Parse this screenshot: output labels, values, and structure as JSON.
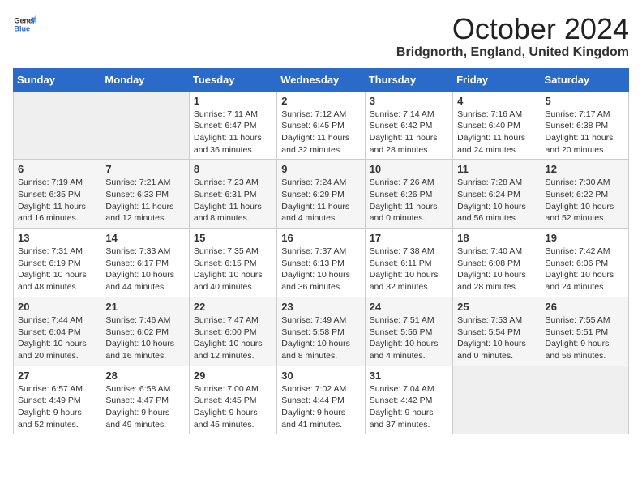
{
  "header": {
    "logo_general": "General",
    "logo_blue": "Blue",
    "month_title": "October 2024",
    "location": "Bridgnorth, England, United Kingdom"
  },
  "days_of_week": [
    "Sunday",
    "Monday",
    "Tuesday",
    "Wednesday",
    "Thursday",
    "Friday",
    "Saturday"
  ],
  "weeks": [
    [
      {
        "day": "",
        "sunrise": "",
        "sunset": "",
        "daylight": ""
      },
      {
        "day": "",
        "sunrise": "",
        "sunset": "",
        "daylight": ""
      },
      {
        "day": "1",
        "sunrise": "Sunrise: 7:11 AM",
        "sunset": "Sunset: 6:47 PM",
        "daylight": "Daylight: 11 hours and 36 minutes."
      },
      {
        "day": "2",
        "sunrise": "Sunrise: 7:12 AM",
        "sunset": "Sunset: 6:45 PM",
        "daylight": "Daylight: 11 hours and 32 minutes."
      },
      {
        "day": "3",
        "sunrise": "Sunrise: 7:14 AM",
        "sunset": "Sunset: 6:42 PM",
        "daylight": "Daylight: 11 hours and 28 minutes."
      },
      {
        "day": "4",
        "sunrise": "Sunrise: 7:16 AM",
        "sunset": "Sunset: 6:40 PM",
        "daylight": "Daylight: 11 hours and 24 minutes."
      },
      {
        "day": "5",
        "sunrise": "Sunrise: 7:17 AM",
        "sunset": "Sunset: 6:38 PM",
        "daylight": "Daylight: 11 hours and 20 minutes."
      }
    ],
    [
      {
        "day": "6",
        "sunrise": "Sunrise: 7:19 AM",
        "sunset": "Sunset: 6:35 PM",
        "daylight": "Daylight: 11 hours and 16 minutes."
      },
      {
        "day": "7",
        "sunrise": "Sunrise: 7:21 AM",
        "sunset": "Sunset: 6:33 PM",
        "daylight": "Daylight: 11 hours and 12 minutes."
      },
      {
        "day": "8",
        "sunrise": "Sunrise: 7:23 AM",
        "sunset": "Sunset: 6:31 PM",
        "daylight": "Daylight: 11 hours and 8 minutes."
      },
      {
        "day": "9",
        "sunrise": "Sunrise: 7:24 AM",
        "sunset": "Sunset: 6:29 PM",
        "daylight": "Daylight: 11 hours and 4 minutes."
      },
      {
        "day": "10",
        "sunrise": "Sunrise: 7:26 AM",
        "sunset": "Sunset: 6:26 PM",
        "daylight": "Daylight: 11 hours and 0 minutes."
      },
      {
        "day": "11",
        "sunrise": "Sunrise: 7:28 AM",
        "sunset": "Sunset: 6:24 PM",
        "daylight": "Daylight: 10 hours and 56 minutes."
      },
      {
        "day": "12",
        "sunrise": "Sunrise: 7:30 AM",
        "sunset": "Sunset: 6:22 PM",
        "daylight": "Daylight: 10 hours and 52 minutes."
      }
    ],
    [
      {
        "day": "13",
        "sunrise": "Sunrise: 7:31 AM",
        "sunset": "Sunset: 6:19 PM",
        "daylight": "Daylight: 10 hours and 48 minutes."
      },
      {
        "day": "14",
        "sunrise": "Sunrise: 7:33 AM",
        "sunset": "Sunset: 6:17 PM",
        "daylight": "Daylight: 10 hours and 44 minutes."
      },
      {
        "day": "15",
        "sunrise": "Sunrise: 7:35 AM",
        "sunset": "Sunset: 6:15 PM",
        "daylight": "Daylight: 10 hours and 40 minutes."
      },
      {
        "day": "16",
        "sunrise": "Sunrise: 7:37 AM",
        "sunset": "Sunset: 6:13 PM",
        "daylight": "Daylight: 10 hours and 36 minutes."
      },
      {
        "day": "17",
        "sunrise": "Sunrise: 7:38 AM",
        "sunset": "Sunset: 6:11 PM",
        "daylight": "Daylight: 10 hours and 32 minutes."
      },
      {
        "day": "18",
        "sunrise": "Sunrise: 7:40 AM",
        "sunset": "Sunset: 6:08 PM",
        "daylight": "Daylight: 10 hours and 28 minutes."
      },
      {
        "day": "19",
        "sunrise": "Sunrise: 7:42 AM",
        "sunset": "Sunset: 6:06 PM",
        "daylight": "Daylight: 10 hours and 24 minutes."
      }
    ],
    [
      {
        "day": "20",
        "sunrise": "Sunrise: 7:44 AM",
        "sunset": "Sunset: 6:04 PM",
        "daylight": "Daylight: 10 hours and 20 minutes."
      },
      {
        "day": "21",
        "sunrise": "Sunrise: 7:46 AM",
        "sunset": "Sunset: 6:02 PM",
        "daylight": "Daylight: 10 hours and 16 minutes."
      },
      {
        "day": "22",
        "sunrise": "Sunrise: 7:47 AM",
        "sunset": "Sunset: 6:00 PM",
        "daylight": "Daylight: 10 hours and 12 minutes."
      },
      {
        "day": "23",
        "sunrise": "Sunrise: 7:49 AM",
        "sunset": "Sunset: 5:58 PM",
        "daylight": "Daylight: 10 hours and 8 minutes."
      },
      {
        "day": "24",
        "sunrise": "Sunrise: 7:51 AM",
        "sunset": "Sunset: 5:56 PM",
        "daylight": "Daylight: 10 hours and 4 minutes."
      },
      {
        "day": "25",
        "sunrise": "Sunrise: 7:53 AM",
        "sunset": "Sunset: 5:54 PM",
        "daylight": "Daylight: 10 hours and 0 minutes."
      },
      {
        "day": "26",
        "sunrise": "Sunrise: 7:55 AM",
        "sunset": "Sunset: 5:51 PM",
        "daylight": "Daylight: 9 hours and 56 minutes."
      }
    ],
    [
      {
        "day": "27",
        "sunrise": "Sunrise: 6:57 AM",
        "sunset": "Sunset: 4:49 PM",
        "daylight": "Daylight: 9 hours and 52 minutes."
      },
      {
        "day": "28",
        "sunrise": "Sunrise: 6:58 AM",
        "sunset": "Sunset: 4:47 PM",
        "daylight": "Daylight: 9 hours and 49 minutes."
      },
      {
        "day": "29",
        "sunrise": "Sunrise: 7:00 AM",
        "sunset": "Sunset: 4:45 PM",
        "daylight": "Daylight: 9 hours and 45 minutes."
      },
      {
        "day": "30",
        "sunrise": "Sunrise: 7:02 AM",
        "sunset": "Sunset: 4:44 PM",
        "daylight": "Daylight: 9 hours and 41 minutes."
      },
      {
        "day": "31",
        "sunrise": "Sunrise: 7:04 AM",
        "sunset": "Sunset: 4:42 PM",
        "daylight": "Daylight: 9 hours and 37 minutes."
      },
      {
        "day": "",
        "sunrise": "",
        "sunset": "",
        "daylight": ""
      },
      {
        "day": "",
        "sunrise": "",
        "sunset": "",
        "daylight": ""
      }
    ]
  ]
}
